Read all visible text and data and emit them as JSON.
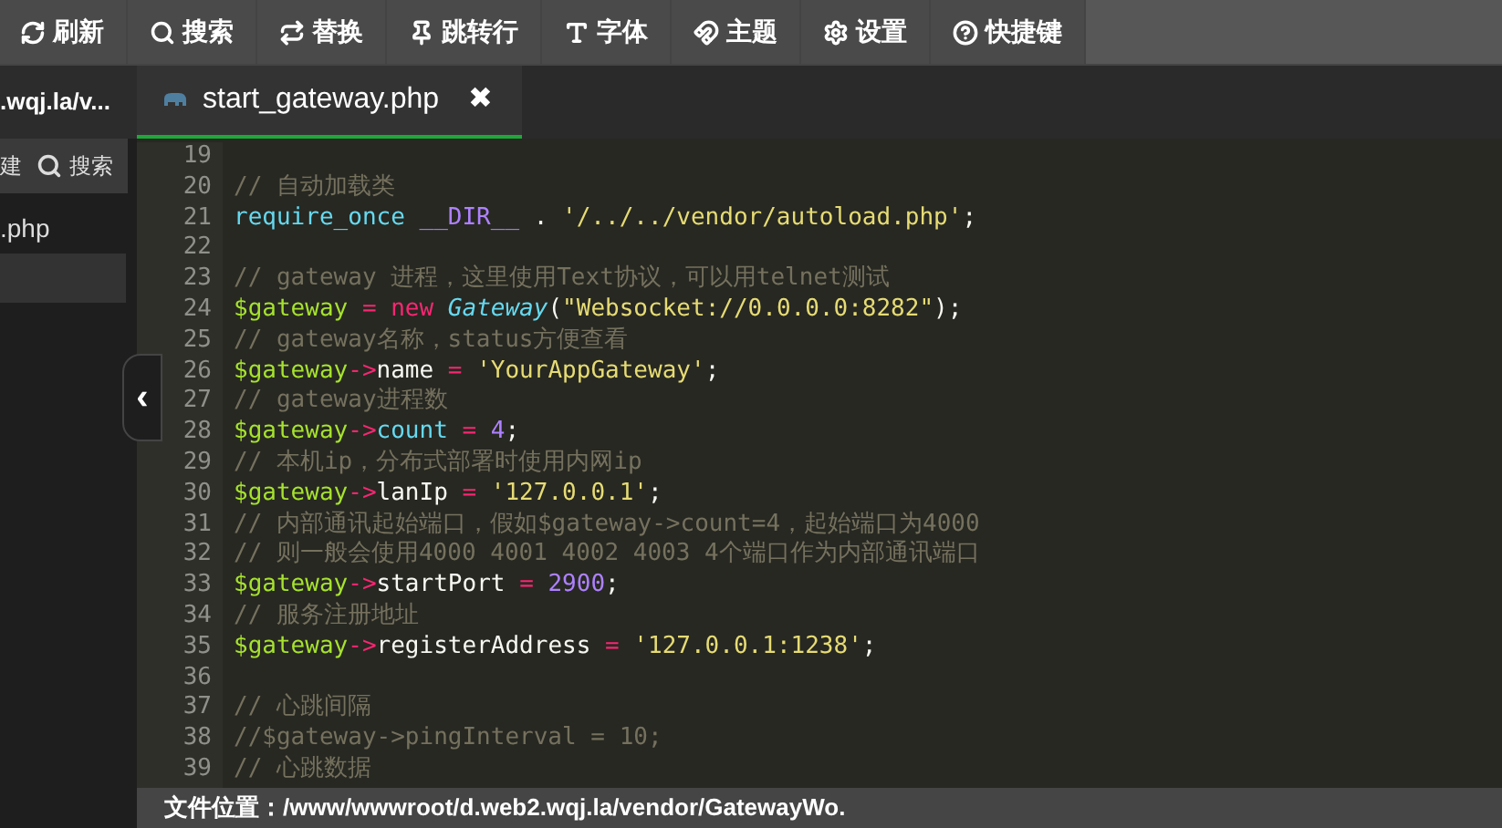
{
  "toolbar": [
    {
      "label": "刷新"
    },
    {
      "label": "搜索"
    },
    {
      "label": "替换"
    },
    {
      "label": "跳转行"
    },
    {
      "label": "字体"
    },
    {
      "label": "主题"
    },
    {
      "label": "设置"
    },
    {
      "label": "快捷键"
    }
  ],
  "sidebar": {
    "path_tab": ".wqj.la/v...",
    "buttons": [
      {
        "label": "建"
      },
      {
        "label": "搜索"
      }
    ],
    "files": [
      {
        "label": ".php",
        "selected": false
      },
      {
        "selected": true
      }
    ]
  },
  "editor_tab": {
    "label": "start_gateway.php",
    "selected": true,
    "close": "✖"
  },
  "collapse_button": "‹",
  "code_lines": [
    {
      "n": "19"
    },
    {
      "n": "20",
      "tokens": [
        {
          "kind": "comment",
          "t": "// 自动加载类"
        }
      ]
    },
    {
      "n": "21",
      "tokens": [
        {
          "kind": "keyword",
          "t": "require_once "
        },
        {
          "kind": "const",
          "t": "__DIR__"
        },
        {
          "kind": "plain",
          "t": " . "
        },
        {
          "kind": "string",
          "t": "'/../../vendor/autoload.php'"
        },
        {
          "kind": "plain",
          "t": ";"
        }
      ]
    },
    {
      "n": "22"
    },
    {
      "n": "23",
      "tokens": [
        {
          "kind": "comment",
          "t": "// gateway 进程，这里使用Text协议，可以用telnet测试"
        }
      ]
    },
    {
      "n": "24",
      "tokens": [
        {
          "kind": "var",
          "t": "$gateway "
        },
        {
          "kind": "op",
          "t": "= new "
        },
        {
          "kind": "class",
          "t": "Gateway"
        },
        {
          "kind": "plain",
          "t": "("
        },
        {
          "kind": "string",
          "t": "\"Websocket://0.0.0.0:8282\""
        },
        {
          "kind": "plain",
          "t": ");"
        }
      ]
    },
    {
      "n": "25",
      "tokens": [
        {
          "kind": "comment",
          "t": "// gateway名称，status方便查看"
        }
      ]
    },
    {
      "n": "26",
      "tokens": [
        {
          "kind": "var",
          "t": "$gateway"
        },
        {
          "kind": "op",
          "t": "->"
        },
        {
          "kind": "plain",
          "t": "name "
        },
        {
          "kind": "op",
          "t": "= "
        },
        {
          "kind": "string",
          "t": "'YourAppGateway'"
        },
        {
          "kind": "plain",
          "t": ";"
        }
      ]
    },
    {
      "n": "27",
      "tokens": [
        {
          "kind": "comment",
          "t": "// gateway进程数"
        }
      ]
    },
    {
      "n": "28",
      "tokens": [
        {
          "kind": "var",
          "t": "$gateway"
        },
        {
          "kind": "op",
          "t": "->"
        },
        {
          "kind": "keyword",
          "t": "count "
        },
        {
          "kind": "op",
          "t": "= "
        },
        {
          "kind": "const",
          "t": "4"
        },
        {
          "kind": "plain",
          "t": ";"
        }
      ]
    },
    {
      "n": "29",
      "tokens": [
        {
          "kind": "comment",
          "t": "// 本机ip，分布式部署时使用内网ip"
        }
      ]
    },
    {
      "n": "30",
      "tokens": [
        {
          "kind": "var",
          "t": "$gateway"
        },
        {
          "kind": "op",
          "t": "->"
        },
        {
          "kind": "plain",
          "t": "lanIp "
        },
        {
          "kind": "op",
          "t": "= "
        },
        {
          "kind": "string",
          "t": "'127.0.0.1'"
        },
        {
          "kind": "plain",
          "t": ";"
        }
      ]
    },
    {
      "n": "31",
      "tokens": [
        {
          "kind": "comment",
          "t": "// 内部通讯起始端口，假如$gateway->count=4，起始端口为4000"
        }
      ]
    },
    {
      "n": "32",
      "tokens": [
        {
          "kind": "comment",
          "t": "// 则一般会使用4000 4001 4002 4003 4个端口作为内部通讯端口"
        }
      ]
    },
    {
      "n": "33",
      "tokens": [
        {
          "kind": "var",
          "t": "$gateway"
        },
        {
          "kind": "op",
          "t": "->"
        },
        {
          "kind": "plain",
          "t": "startPort "
        },
        {
          "kind": "op",
          "t": "= "
        },
        {
          "kind": "const",
          "t": "2900"
        },
        {
          "kind": "plain",
          "t": ";"
        }
      ]
    },
    {
      "n": "34",
      "tokens": [
        {
          "kind": "comment",
          "t": "// 服务注册地址"
        }
      ]
    },
    {
      "n": "35",
      "tokens": [
        {
          "kind": "var",
          "t": "$gateway"
        },
        {
          "kind": "op",
          "t": "->"
        },
        {
          "kind": "plain",
          "t": "registerAddress "
        },
        {
          "kind": "op",
          "t": "= "
        },
        {
          "kind": "string",
          "t": "'127.0.0.1:1238'"
        },
        {
          "kind": "plain",
          "t": ";"
        }
      ]
    },
    {
      "n": "36"
    },
    {
      "n": "37",
      "tokens": [
        {
          "kind": "comment",
          "t": "// 心跳间隔"
        }
      ]
    },
    {
      "n": "38",
      "tokens": [
        {
          "kind": "comment",
          "t": "//$gateway->pingInterval = 10;"
        }
      ]
    },
    {
      "n": "39",
      "tokens": [
        {
          "kind": "comment",
          "t": "// 心跳数据"
        }
      ]
    }
  ],
  "status_bar": "文件位置：/www/wwwroot/d.web2.wqj.la/vendor/GatewayWo."
}
